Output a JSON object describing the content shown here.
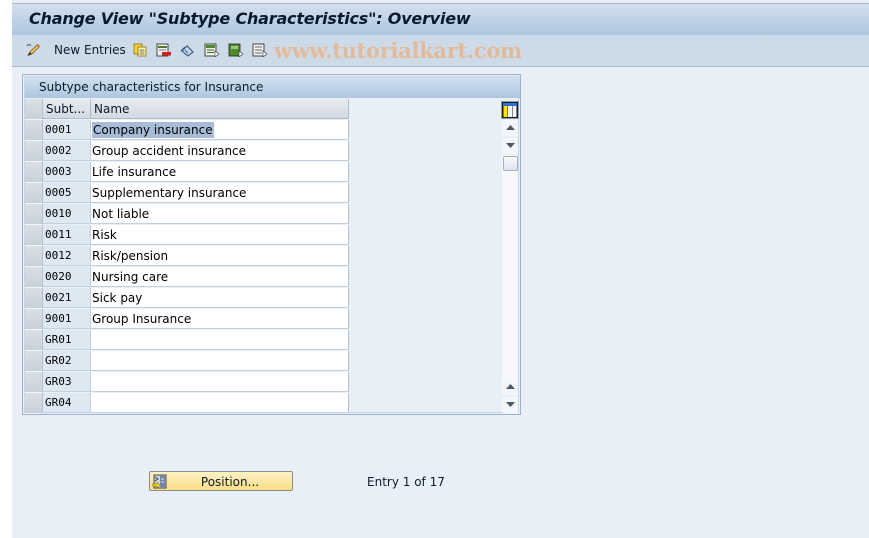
{
  "window": {
    "title": "Change View \"Subtype Characteristics\": Overview"
  },
  "toolbar": {
    "new_entries_label": "New Entries",
    "icons": [
      "edit-pencil-icon",
      "copy-as-icon",
      "delete-icon",
      "undo-change-icon",
      "select-all-icon",
      "select-block-icon",
      "deselect-all-icon"
    ],
    "watermark": "www.tutorialkart.com"
  },
  "table": {
    "title": "Subtype characteristics for Insurance",
    "columns": [
      "Subt...",
      "Name"
    ],
    "rows": [
      {
        "key": "0001",
        "name": "Company insurance",
        "highlighted": true
      },
      {
        "key": "0002",
        "name": "Group accident insurance"
      },
      {
        "key": "0003",
        "name": "Life insurance"
      },
      {
        "key": "0005",
        "name": "Supplementary insurance"
      },
      {
        "key": "0010",
        "name": "Not liable"
      },
      {
        "key": "0011",
        "name": "Risk"
      },
      {
        "key": "0012",
        "name": "Risk/pension"
      },
      {
        "key": "0020",
        "name": "Nursing care"
      },
      {
        "key": "0021",
        "name": "Sick pay"
      },
      {
        "key": "9001",
        "name": "Group Insurance"
      },
      {
        "key": "GR01",
        "name": ""
      },
      {
        "key": "GR02",
        "name": ""
      },
      {
        "key": "GR03",
        "name": ""
      },
      {
        "key": "GR04",
        "name": ""
      }
    ]
  },
  "footer": {
    "position_button_label": "Position...",
    "entry_info": "Entry 1 of 17"
  },
  "colors": {
    "title_gradient_top": "#d3e0ef",
    "title_gradient_bottom": "#adc5de",
    "toolbar_bg": "#cddbe8",
    "content_bg": "#e8eff7",
    "selection_highlight": "#a7bdd7",
    "position_button": "#f8de84",
    "watermark": "#e8b58c"
  }
}
